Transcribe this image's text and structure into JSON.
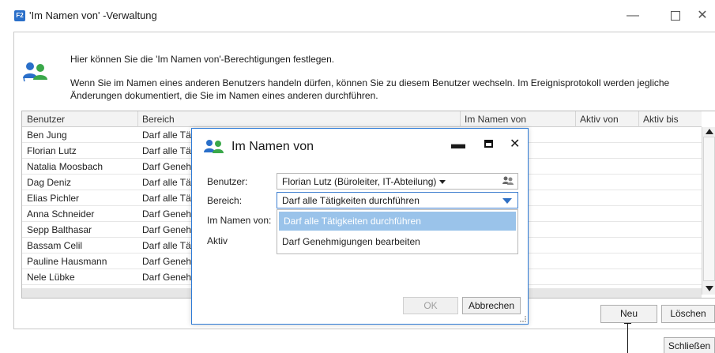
{
  "window": {
    "app_badge": "F2",
    "title": "'Im Namen von' -Verwaltung",
    "min_glyph": "—",
    "close_glyph": "✕"
  },
  "intro": {
    "line1": "Hier können Sie die 'Im Namen von'-Berechtigungen festlegen.",
    "line2": "Wenn Sie im Namen eines anderen Benutzers handeln dürfen, können Sie zu diesem Benutzer wechseln. Im Ereignisprotokoll werden jegliche Änderungen dokumentiert, die Sie im Namen eines anderen durchführen."
  },
  "table": {
    "columns": [
      "Benutzer",
      "Bereich",
      "Im Namen von",
      "Aktiv von",
      "Aktiv bis"
    ],
    "rows": [
      {
        "benutzer": "Ben Jung",
        "bereich": "Darf alle Täti"
      },
      {
        "benutzer": "Florian Lutz",
        "bereich": "Darf alle Täti"
      },
      {
        "benutzer": "Natalia Moosbach",
        "bereich": "Darf Genehr"
      },
      {
        "benutzer": "Dag Deniz",
        "bereich": "Darf alle Täti"
      },
      {
        "benutzer": "Elias Pichler",
        "bereich": "Darf alle Täti"
      },
      {
        "benutzer": "Anna Schneider",
        "bereich": "Darf Genehr"
      },
      {
        "benutzer": "Sepp Balthasar",
        "bereich": "Darf Genehr"
      },
      {
        "benutzer": "Bassam Celil",
        "bereich": "Darf alle Täti"
      },
      {
        "benutzer": "Pauline Hausmann",
        "bereich": "Darf Genehr"
      },
      {
        "benutzer": "Nele Lübke",
        "bereich": "Darf Genehr"
      }
    ]
  },
  "buttons": {
    "neu": "Neu",
    "loeschen": "Löschen",
    "schliessen": "Schließen"
  },
  "dialog": {
    "title": "Im Namen von",
    "min_glyph": "▬",
    "close_glyph": "✕",
    "label_benutzer": "Benutzer:",
    "label_bereich": "Bereich:",
    "label_im_namen_von": "Im Namen von:",
    "label_aktiv": "Aktiv",
    "benutzer_value": "Florian Lutz (Büroleiter, IT-Abteilung)",
    "bereich_value": "Darf alle Tätigkeiten durchführen",
    "bereich_options": [
      "Darf alle Tätigkeiten durchführen",
      "Darf Genehmigungen bearbeiten"
    ],
    "ok": "OK",
    "abbrechen": "Abbrechen"
  },
  "icons": {
    "app": "app-badge-icon",
    "info": "users-icon",
    "dialog": "users-icon",
    "user_picker": "users-picker-icon"
  },
  "colors": {
    "accent": "#2e7bd6",
    "icon_blue": "#2a6fc9",
    "icon_green": "#3aa84a",
    "dropdown_highlight": "#9ac3ea"
  }
}
